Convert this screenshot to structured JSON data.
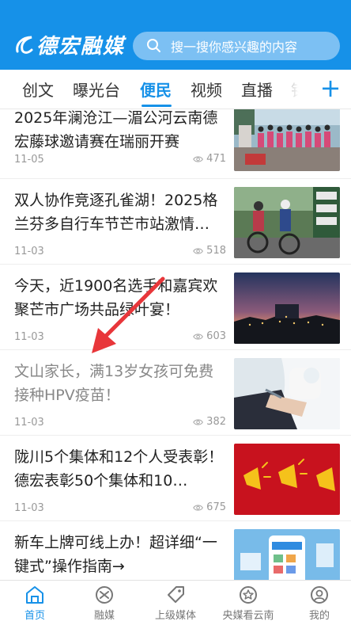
{
  "header": {
    "logo_text": "德宏融媒",
    "search_placeholder": "搜一搜你感兴趣的内容"
  },
  "tabs": [
    {
      "label": "创文"
    },
    {
      "label": "曝光台"
    },
    {
      "label": "便民",
      "active": true
    },
    {
      "label": "视频"
    },
    {
      "label": "直播"
    },
    {
      "label": "铭"
    }
  ],
  "news": [
    {
      "title": "2025年澜沧江—湄公河云南德宏藤球邀请赛在瑞丽开赛",
      "date": "11-05",
      "views": "471",
      "read": false
    },
    {
      "title": "双人协作竞逐孔雀湖！2025格兰芬多自行车节芒市站激情…",
      "date": "11-03",
      "views": "518",
      "read": false
    },
    {
      "title": "今天，近1900名选手和嘉宾欢聚芒市广场共品绿叶宴！",
      "date": "11-03",
      "views": "603",
      "read": false
    },
    {
      "title": "文山家长，满13岁女孩可免费接种HPV疫苗！",
      "date": "11-03",
      "views": "382",
      "read": true
    },
    {
      "title": "陇川5个集体和12个人受表彰！德宏表彰50个集体和10…",
      "date": "11-03",
      "views": "675",
      "read": false
    },
    {
      "title": "新车上牌可线上办！超详细“一键式”操作指南→",
      "date": "",
      "views": "",
      "read": false
    }
  ],
  "bottom_nav": [
    {
      "label": "首页",
      "active": true
    },
    {
      "label": "融媒"
    },
    {
      "label": "上级媒体"
    },
    {
      "label": "央媒看云南"
    },
    {
      "label": "我的"
    }
  ],
  "colors": {
    "brand_blue": "#1691e8",
    "search_bg": "#7cc0f3",
    "arrow_red": "#e8363a"
  }
}
